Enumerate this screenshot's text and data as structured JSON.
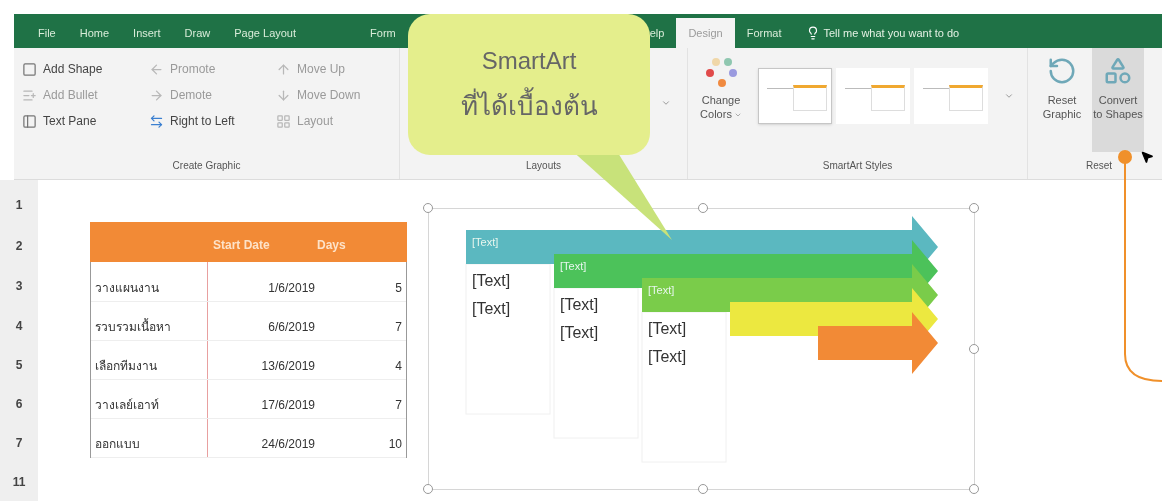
{
  "ribbon": {
    "tabs": [
      {
        "label": "File",
        "selected": false
      },
      {
        "label": "Home",
        "selected": false
      },
      {
        "label": "Insert",
        "selected": false
      },
      {
        "label": "Draw",
        "selected": false
      },
      {
        "label": "Page Layout",
        "selected": false
      },
      {
        "label": "Form",
        "selected": false
      },
      {
        "label": "elp",
        "selected": false
      },
      {
        "label": "Design",
        "selected": true
      },
      {
        "label": "Format",
        "selected": false
      }
    ],
    "tell_me": "Tell me what you want to do",
    "create_graphic": {
      "label": "Create Graphic",
      "commands": [
        {
          "label": "Add Shape",
          "disabled": false
        },
        {
          "label": "Add Bullet",
          "disabled": true
        },
        {
          "label": "Text Pane",
          "disabled": false
        },
        {
          "label": "Promote",
          "disabled": true
        },
        {
          "label": "Demote",
          "disabled": true
        },
        {
          "label": "Right to Left",
          "disabled": false
        },
        {
          "label": "Move Up",
          "disabled": true
        },
        {
          "label": "Move Down",
          "disabled": true
        },
        {
          "label": "Layout",
          "disabled": true
        }
      ]
    },
    "layouts": {
      "label": "Layouts"
    },
    "change_colors": {
      "line1": "Change",
      "line2": "Colors"
    },
    "styles": {
      "label": "SmartArt Styles",
      "thumbnails": [
        {
          "selected": true
        },
        {
          "selected": false
        },
        {
          "selected": false
        }
      ]
    },
    "reset": {
      "label": "Reset",
      "buttons": [
        {
          "line1": "Reset",
          "line2": "Graphic",
          "selected": false
        },
        {
          "line1": "Convert",
          "line2": "to Shapes",
          "selected": true
        }
      ]
    }
  },
  "callout": {
    "lines": [
      "SmartArt",
      "ที่ได้เบื้องต้น"
    ]
  },
  "sheet": {
    "row_headers": [
      "1",
      "2",
      "3",
      "4",
      "5",
      "6",
      "7",
      "11"
    ],
    "table": {
      "columns": [
        "Start Date",
        "Days"
      ],
      "rows": [
        {
          "task": "วางแผนงาน",
          "start": "1/6/2019",
          "days": "5"
        },
        {
          "task": "รวบรวมเนื้อหา",
          "start": "6/6/2019",
          "days": "7"
        },
        {
          "task": "เลือกทีมงาน",
          "start": "13/6/2019",
          "days": "4"
        },
        {
          "task": "วางเลย์เอาท์",
          "start": "17/6/2019",
          "days": "7"
        },
        {
          "task": "ออกแบบ",
          "start": "24/6/2019",
          "days": "10"
        }
      ]
    }
  },
  "smartart": {
    "items": [
      {
        "label": "[Text]",
        "color": "#5bb8c0",
        "bullets": [
          "[Text]",
          "[Text]"
        ]
      },
      {
        "label": "[Text]",
        "color": "#4cc25a",
        "bullets": [
          "[Text]",
          "[Text]"
        ]
      },
      {
        "label": "[Text]",
        "color": "#7acc4a",
        "bullets": [
          "[Text]",
          "[Text]"
        ]
      },
      {
        "color": "#ece840"
      },
      {
        "color": "#f28a36"
      }
    ]
  }
}
